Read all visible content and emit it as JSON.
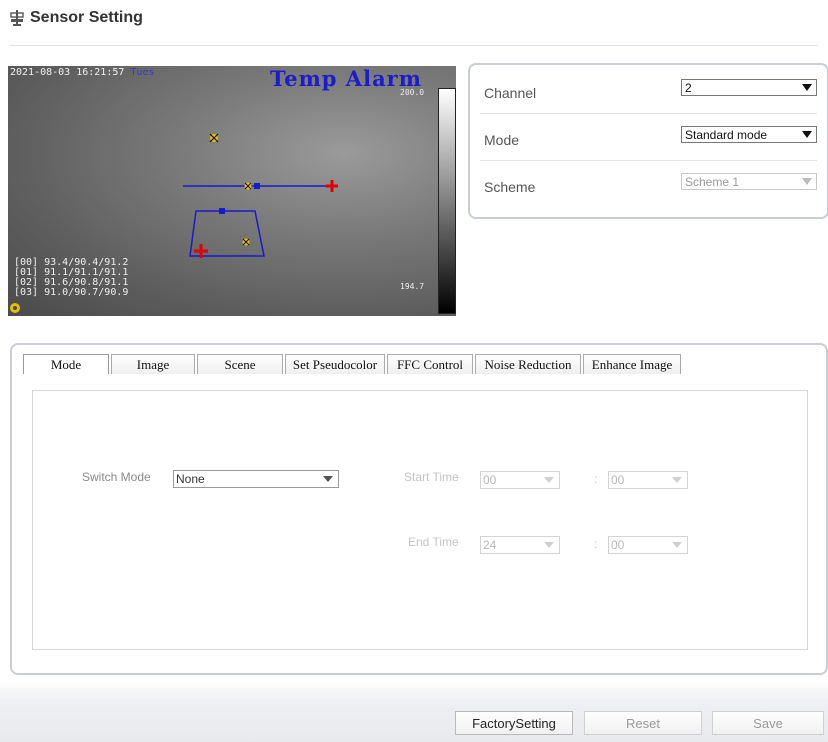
{
  "header": {
    "title": "Sensor Setting",
    "icon": "settings-pin-icon"
  },
  "video": {
    "timestamp": "2021-08-03 16:21:57",
    "weekday": "Tues",
    "alarm_text": "Temp Alarm",
    "scale_max": "200.0",
    "scale_min": "194.7",
    "readings": [
      "[00] 93.4/90.4/91.2",
      "[01] 91.1/91.1/91.1",
      "[02] 91.6/90.8/91.1",
      "[03] 91.0/90.7/90.9"
    ]
  },
  "settings": {
    "channel": {
      "label": "Channel",
      "value": "2"
    },
    "mode": {
      "label": "Mode",
      "value": "Standard mode"
    },
    "scheme": {
      "label": "Scheme",
      "value": "Scheme 1"
    }
  },
  "tabs": [
    "Mode",
    "Image",
    "Scene",
    "Set Pseudocolor",
    "FFC Control",
    "Noise Reduction",
    "Enhance Image"
  ],
  "mode_tab": {
    "switch_mode": {
      "label": "Switch Mode",
      "value": "None"
    },
    "start_time": {
      "label": "Start Time",
      "hour": "00",
      "minute": "00"
    },
    "end_time": {
      "label": "End Time",
      "hour": "24",
      "minute": "00"
    },
    "separator": ":"
  },
  "buttons": {
    "factory": "FactorySetting",
    "reset": "Reset",
    "save": "Save"
  }
}
